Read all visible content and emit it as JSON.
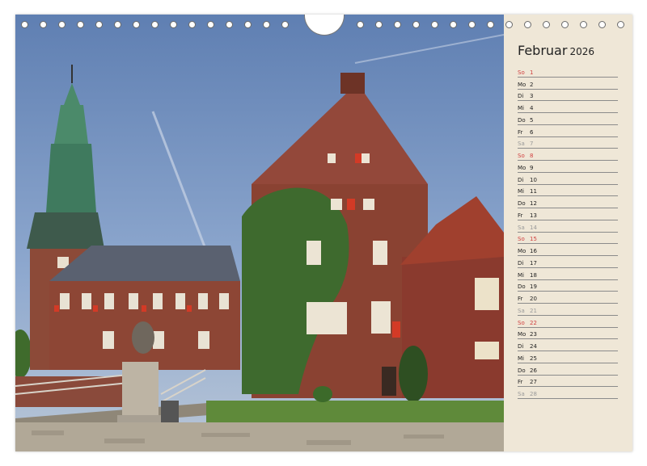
{
  "calendar": {
    "month": "Februar",
    "year": "2026",
    "days": [
      {
        "abbr": "So",
        "num": "1",
        "kind": "sun"
      },
      {
        "abbr": "Mo",
        "num": "2",
        "kind": "week"
      },
      {
        "abbr": "Di",
        "num": "3",
        "kind": "week"
      },
      {
        "abbr": "Mi",
        "num": "4",
        "kind": "week"
      },
      {
        "abbr": "Do",
        "num": "5",
        "kind": "week"
      },
      {
        "abbr": "Fr",
        "num": "6",
        "kind": "week"
      },
      {
        "abbr": "Sa",
        "num": "7",
        "kind": "sat"
      },
      {
        "abbr": "So",
        "num": "8",
        "kind": "sun"
      },
      {
        "abbr": "Mo",
        "num": "9",
        "kind": "week"
      },
      {
        "abbr": "Di",
        "num": "10",
        "kind": "week"
      },
      {
        "abbr": "Mi",
        "num": "11",
        "kind": "week"
      },
      {
        "abbr": "Do",
        "num": "12",
        "kind": "week"
      },
      {
        "abbr": "Fr",
        "num": "13",
        "kind": "week"
      },
      {
        "abbr": "Sa",
        "num": "14",
        "kind": "sat"
      },
      {
        "abbr": "So",
        "num": "15",
        "kind": "sun"
      },
      {
        "abbr": "Mo",
        "num": "16",
        "kind": "week"
      },
      {
        "abbr": "Di",
        "num": "17",
        "kind": "week"
      },
      {
        "abbr": "Mi",
        "num": "18",
        "kind": "week"
      },
      {
        "abbr": "Do",
        "num": "19",
        "kind": "week"
      },
      {
        "abbr": "Fr",
        "num": "20",
        "kind": "week"
      },
      {
        "abbr": "Sa",
        "num": "21",
        "kind": "sat"
      },
      {
        "abbr": "So",
        "num": "22",
        "kind": "sun"
      },
      {
        "abbr": "Mo",
        "num": "23",
        "kind": "week"
      },
      {
        "abbr": "Di",
        "num": "24",
        "kind": "week"
      },
      {
        "abbr": "Mi",
        "num": "25",
        "kind": "week"
      },
      {
        "abbr": "Do",
        "num": "26",
        "kind": "week"
      },
      {
        "abbr": "Fr",
        "num": "27",
        "kind": "week"
      },
      {
        "abbr": "Sa",
        "num": "28",
        "kind": "sat"
      }
    ]
  },
  "colors": {
    "panel_background": "#efe7d7",
    "sunday": "#d04040",
    "saturday": "#999999",
    "weekday": "#222222",
    "brick": "#9a4a38"
  },
  "photo": {
    "icon": "castle-photo"
  }
}
